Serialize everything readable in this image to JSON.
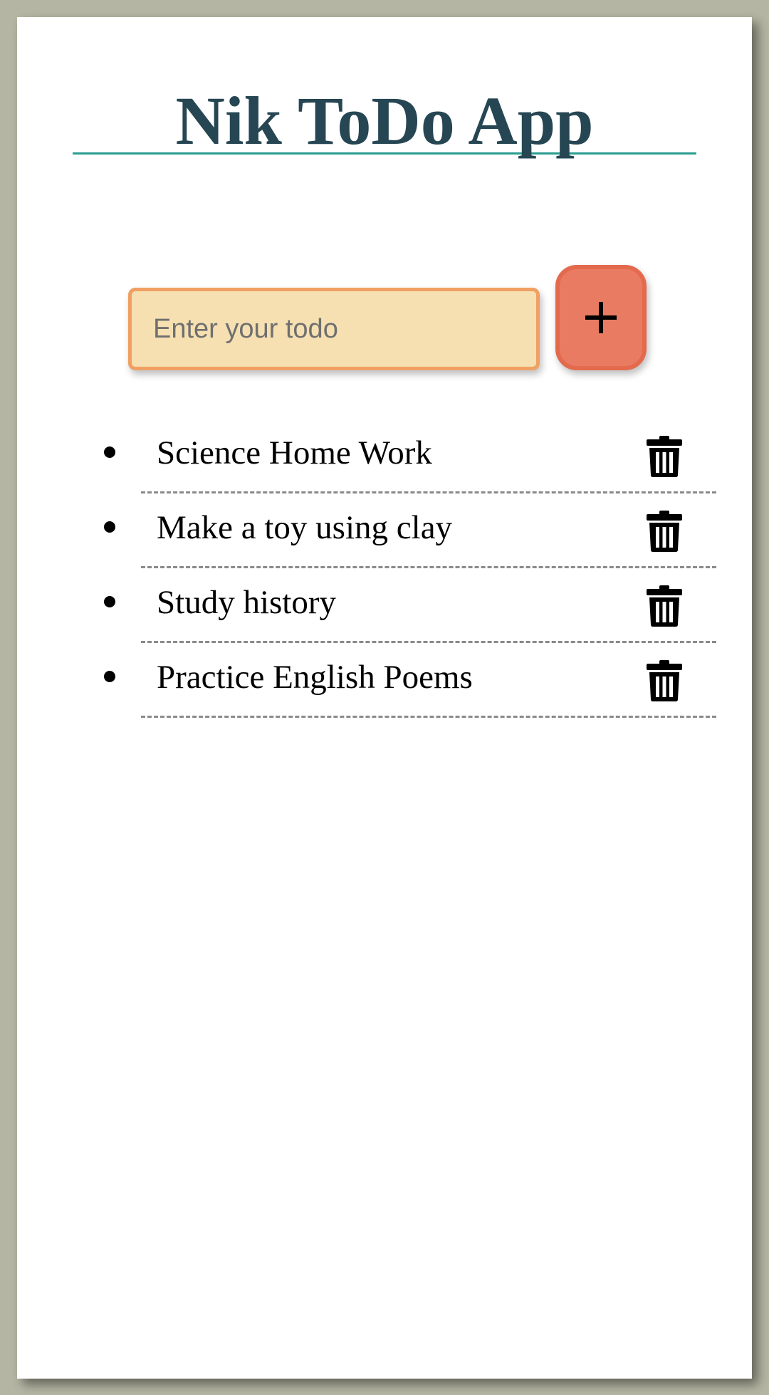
{
  "app": {
    "title": "Nik ToDo App"
  },
  "form": {
    "input_placeholder": "Enter your todo",
    "input_value": "",
    "add_button_icon": "plus-icon"
  },
  "todos": [
    {
      "text": "Science Home Work",
      "delete_icon": "trash-icon"
    },
    {
      "text": "Make a toy using clay",
      "delete_icon": "trash-icon"
    },
    {
      "text": "Study history",
      "delete_icon": "trash-icon"
    },
    {
      "text": "Practice English Poems",
      "delete_icon": "trash-icon"
    }
  ],
  "colors": {
    "page_background": "#b5b5a3",
    "card_background": "#ffffff",
    "title_color": "#264653",
    "header_rule": "#2a9d8f",
    "input_background": "#f6e0b1",
    "input_border": "#f0a062",
    "add_button_background": "#e97b62",
    "add_button_border": "#e46a4e",
    "item_divider": "#8a8a8a"
  }
}
